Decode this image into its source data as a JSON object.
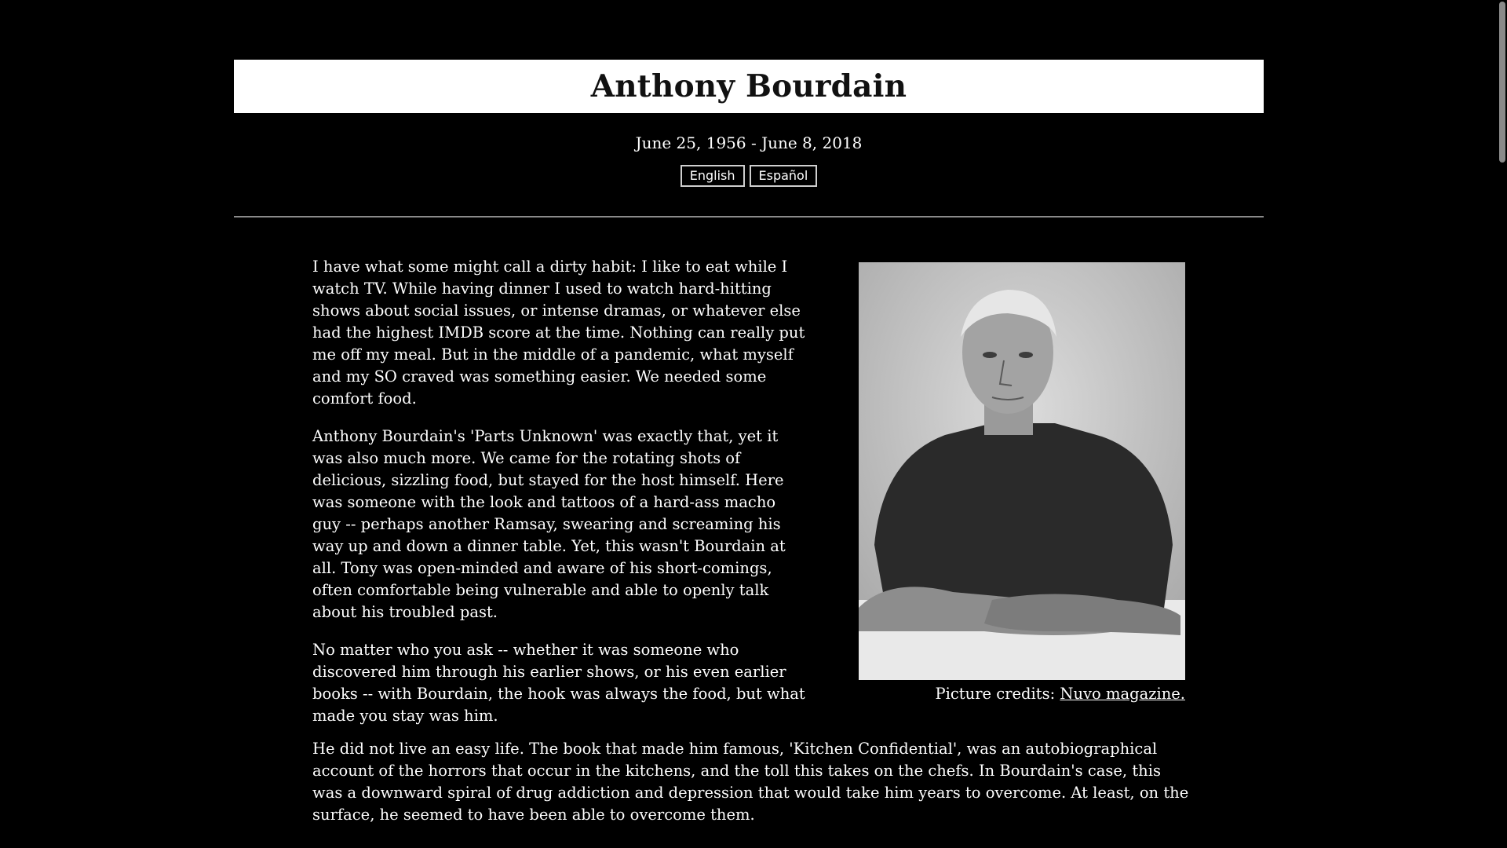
{
  "header": {
    "title": "Anthony Bourdain",
    "dates": "June 25, 1956 - June 8, 2018"
  },
  "languages": {
    "english": "English",
    "spanish": "Español"
  },
  "article": {
    "paragraphs": [
      "I have what some might call a dirty habit: I like to eat while I watch TV. While having dinner I used to watch hard-hitting shows about social issues, or intense dramas, or whatever else had the highest IMDB score at the time. Nothing can really put me off my meal. But in the middle of a pandemic, what myself and my SO craved was something easier. We needed some comfort food.",
      "Anthony Bourdain's 'Parts Unknown' was exactly that, yet it was also much more. We came for the rotating shots of delicious, sizzling food, but stayed for the host himself. Here was someone with the look and tattoos of a hard-ass macho guy -- perhaps another Ramsay, swearing and screaming his way up and down a dinner table. Yet, this wasn't Bourdain at all. Tony was open-minded and aware of his short-comings, often comfortable being vulnerable and able to openly talk about his troubled past.",
      "No matter who you ask -- whether it was someone who discovered him through his earlier shows, or his even earlier books -- with Bourdain, the hook was always the food, but what made you stay was him.",
      "He did not live an easy life. The book that made him famous, 'Kitchen Confidential', was an autobiographical account of the horrors that occur in the kitchens, and the toll this takes on the chefs. In Bourdain's case, this was a downward spiral of drug addiction and depression that would take him years to overcome. At least, on the surface, he seemed to have been able to overcome them."
    ]
  },
  "figure": {
    "caption_prefix": "Picture credits: ",
    "caption_link": "Nuvo magazine."
  }
}
